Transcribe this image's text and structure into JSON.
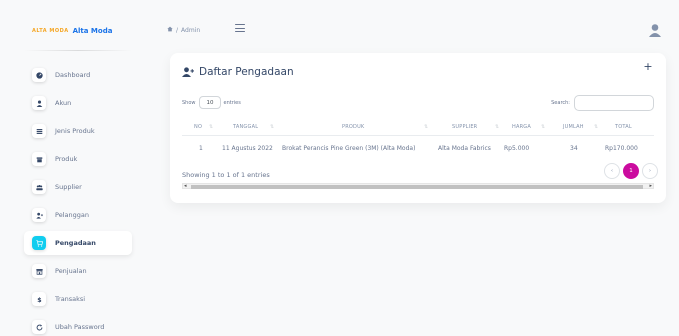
{
  "brand": {
    "mark": "ALTA MODA",
    "name": "Alta Moda"
  },
  "sidebar": {
    "items": [
      {
        "label": "Dashboard",
        "icon": "dashboard-icon"
      },
      {
        "label": "Akun",
        "icon": "user-icon"
      },
      {
        "label": "Jenis Produk",
        "icon": "list-icon"
      },
      {
        "label": "Produk",
        "icon": "box-icon"
      },
      {
        "label": "Supplier",
        "icon": "users-icon"
      },
      {
        "label": "Pelanggan",
        "icon": "user-plus-icon"
      },
      {
        "label": "Pengadaan",
        "icon": "cart-icon",
        "active": true
      },
      {
        "label": "Penjualan",
        "icon": "store-icon"
      },
      {
        "label": "Transaksi",
        "icon": "dollar-icon"
      },
      {
        "label": "Ubah Password",
        "icon": "refresh-icon"
      }
    ]
  },
  "topbar": {
    "breadcrumb_sep": "/",
    "breadcrumb_current": "Admin"
  },
  "card": {
    "title": "Daftar Pengadaan",
    "add_label": "+",
    "show_label": "Show",
    "show_value": "10",
    "entries_label": "entries",
    "search_label": "Search:",
    "columns": [
      "NO",
      "TANGGAL",
      "PRODUK",
      "SUPPLIER",
      "HARGA",
      "JUMLAH",
      "TOTAL"
    ],
    "rows": [
      [
        "1",
        "11 Agustus 2022",
        "Brokat Perancis Pine Green (3M) (Alta Moda)",
        "Alta Moda Fabrics",
        "Rp5.000",
        "34",
        "Rp170.000"
      ]
    ],
    "info": "Showing 1 to 1 of 1 entries",
    "pagination": {
      "prev": "‹",
      "current": "1",
      "next": "›"
    }
  },
  "colors": {
    "accent": "#cb0c9f",
    "active_icon": "#11cdef",
    "brand": "#1a73e8"
  }
}
